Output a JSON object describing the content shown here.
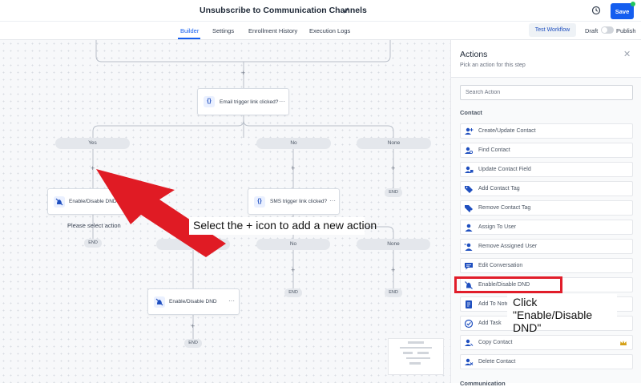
{
  "header": {
    "title": "Unsubscribe to Communication Channels",
    "save_label": "Save"
  },
  "tabs": [
    {
      "label": "Builder"
    },
    {
      "label": "Settings"
    },
    {
      "label": "Enrollment History"
    },
    {
      "label": "Execution Logs"
    }
  ],
  "toolbar": {
    "test_workflow_label": "Test Workflow",
    "draft_label": "Draft",
    "publish_label": "Publish"
  },
  "canvas": {
    "email_trigger_label": "Email trigger link clicked?",
    "sms_trigger_label": "SMS trigger link clicked?",
    "dnd_node_label": "Enable/Disable DND",
    "dnd_node2_label": "Enable/Disable DND",
    "branch_yes": "Yes",
    "branch_no": "No",
    "branch_none": "None",
    "branch2_yes": "Yes",
    "branch2_no": "No",
    "branch2_none": "None",
    "end_label": "END",
    "note_select_action": "Please select action",
    "annotation": "Select the + icon to add a new action"
  },
  "panel": {
    "title": "Actions",
    "subtitle": "Pick an action for this step",
    "search_placeholder": "Search Action",
    "section_contact": "Contact",
    "section_communication": "Communication",
    "items": [
      {
        "label": "Create/Update Contact",
        "icon": "contact-add-icon"
      },
      {
        "label": "Find Contact",
        "icon": "find-contact-icon"
      },
      {
        "label": "Update Contact Field",
        "icon": "update-contact-icon"
      },
      {
        "label": "Add Contact Tag",
        "icon": "tag-icon"
      },
      {
        "label": "Remove Contact Tag",
        "icon": "tag-remove-icon"
      },
      {
        "label": "Assign To User",
        "icon": "assign-user-icon"
      },
      {
        "label": "Remove Assigned User",
        "icon": "remove-user-icon"
      },
      {
        "label": "Edit Conversation",
        "icon": "conversation-icon"
      },
      {
        "label": "Enable/Disable DND",
        "icon": "dnd-icon"
      },
      {
        "label": "Add To Notes",
        "icon": "notes-icon"
      },
      {
        "label": "Add Task",
        "icon": "task-icon"
      },
      {
        "label": "Copy Contact",
        "icon": "copy-contact-icon"
      },
      {
        "label": "Delete Contact",
        "icon": "delete-contact-icon"
      }
    ],
    "callout": "Click \"Enable/Disable DND\""
  },
  "colors": {
    "accent": "#155eef",
    "highlight": "#e11d2a",
    "icon": "#1f4fbf"
  }
}
